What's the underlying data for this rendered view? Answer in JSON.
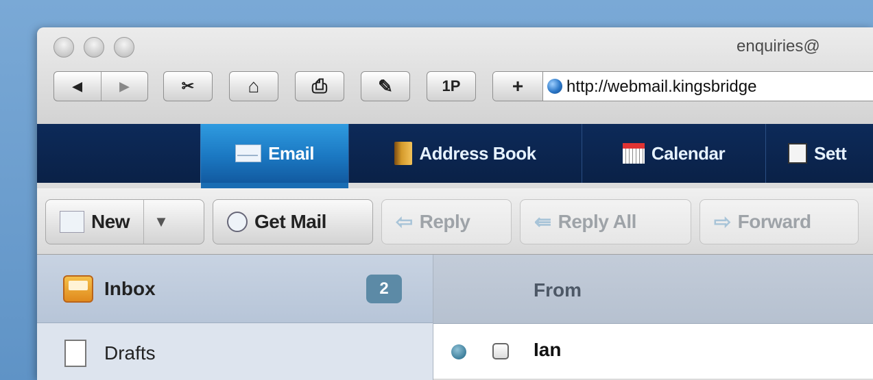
{
  "window": {
    "title": "enquiries@"
  },
  "toolbar": {
    "back_label": "◀",
    "forward_label": "▶",
    "clip_label": "✂",
    "home_label": "⌂",
    "print_label": "⎙",
    "edit_label": "✎",
    "onepassword_label": "1P",
    "add_label": "+",
    "url": "http://webmail.kingsbridge"
  },
  "nav": {
    "tabs": [
      {
        "label": "Email",
        "icon": "envelope-icon",
        "active": true
      },
      {
        "label": "Address Book",
        "icon": "address-book-icon",
        "active": false
      },
      {
        "label": "Calendar",
        "icon": "calendar-icon",
        "active": false
      },
      {
        "label": "Sett",
        "icon": "settings-icon",
        "active": false
      }
    ]
  },
  "actions": {
    "new_label": "New",
    "new_dropdown": "▼",
    "get_mail_label": "Get Mail",
    "reply_label": "Reply",
    "reply_all_label": "Reply All",
    "forward_label": "Forward"
  },
  "folders": [
    {
      "label": "Inbox",
      "icon": "inbox-icon",
      "count": "2",
      "selected": true
    },
    {
      "label": "Drafts",
      "icon": "document-icon",
      "selected": false
    }
  ],
  "message_list": {
    "columns": [
      "From"
    ],
    "rows": [
      {
        "from": "Ian",
        "unread": true
      }
    ]
  },
  "colors": {
    "nav_bg": "#0d2a59",
    "nav_active": "#1b78c2",
    "badge": "#5c8aa6",
    "sidebar_bg": "#dde4ee"
  }
}
